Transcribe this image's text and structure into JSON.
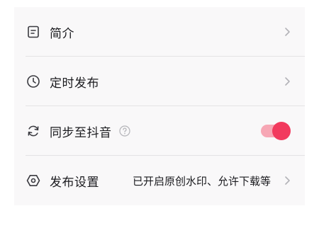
{
  "settings": {
    "items": [
      {
        "label": "简介",
        "icon": "document-icon",
        "has_chevron": true
      },
      {
        "label": "定时发布",
        "icon": "clock-icon",
        "has_chevron": true
      },
      {
        "label": "同步至抖音",
        "icon": "sync-icon",
        "help_icon": "question-icon",
        "toggle_on": true
      },
      {
        "label": "发布设置",
        "icon": "hexagon-settings-icon",
        "value": "已开启原创水印、允许下载等",
        "has_chevron": true
      }
    ]
  },
  "colors": {
    "panel_bg": "#f9f8f9",
    "text": "#1b1b1f",
    "icon": "#3a3a40",
    "chevron": "#b3b3b8",
    "divider": "#e4e3e5",
    "toggle_knob": "#f23a5e",
    "toggle_track": "#f7a7b5"
  }
}
